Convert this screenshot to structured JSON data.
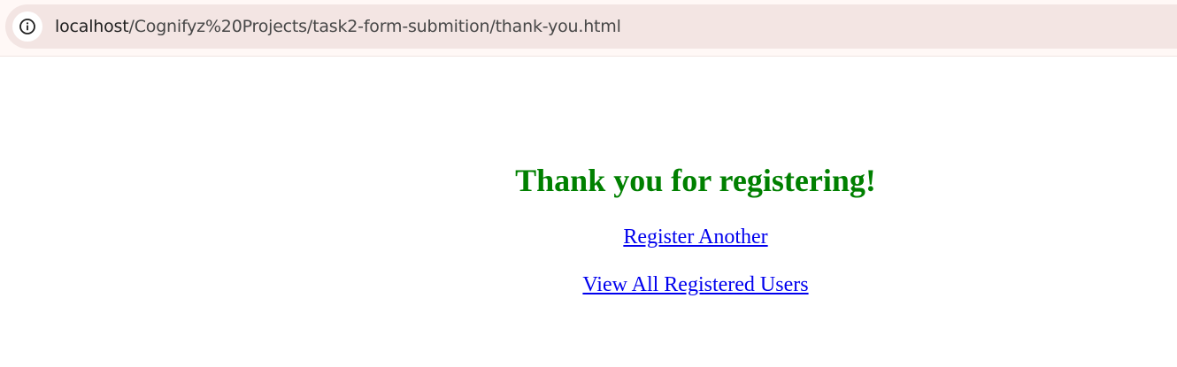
{
  "browser": {
    "url_host": "localhost",
    "url_path": "/Cognifyz%20Projects/task2-form-submition/thank-you.html",
    "info_icon": "info-icon"
  },
  "page": {
    "heading": "Thank you for registering!",
    "heading_color": "#008000",
    "links": [
      {
        "label": "Register Another"
      },
      {
        "label": "View All Registered Users"
      }
    ],
    "link_color": "#0000ee"
  }
}
